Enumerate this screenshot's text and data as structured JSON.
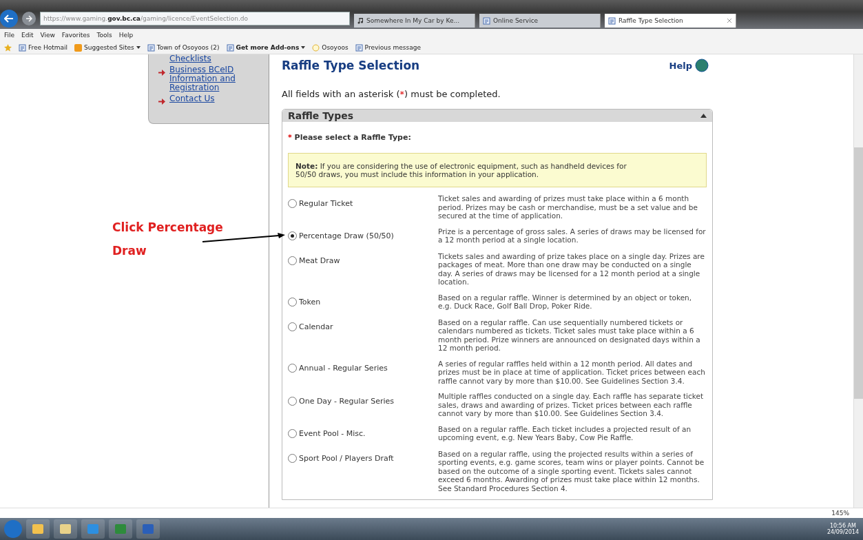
{
  "browser": {
    "url": {
      "prefix": "https://www.gaming.",
      "domain": "gov.bc.ca",
      "path": "/gaming/licence/EventSelection.do"
    },
    "tabs": [
      {
        "label": "Somewhere In My Car by Ke...",
        "kind": "music",
        "selected": false
      },
      {
        "label": "Online Service",
        "kind": "page",
        "selected": false
      },
      {
        "label": "Raffle Type Selection",
        "kind": "page",
        "selected": true
      }
    ],
    "menu": [
      "File",
      "Edit",
      "View",
      "Favorites",
      "Tools",
      "Help"
    ],
    "favorites": [
      {
        "label": "Free Hotmail",
        "kind": "page",
        "dropdown": false,
        "bold": false
      },
      {
        "label": "Suggested Sites",
        "kind": "suggested",
        "dropdown": true,
        "bold": false
      },
      {
        "label": "Town of Osoyoos (2)",
        "kind": "page",
        "dropdown": false,
        "bold": false
      },
      {
        "label": "Get more Add-ons",
        "kind": "page",
        "dropdown": true,
        "bold": true
      },
      {
        "label": "Osoyoos",
        "kind": "circle",
        "dropdown": false,
        "bold": false
      },
      {
        "label": "Previous message",
        "kind": "page",
        "dropdown": false,
        "bold": false
      }
    ],
    "zoom": "145%"
  },
  "sidebar": {
    "links": [
      {
        "label": "Checklists",
        "arrow": false
      },
      {
        "label": "Business BCeID Information and Registration",
        "arrow": true
      },
      {
        "label": "Contact Us",
        "arrow": true
      }
    ]
  },
  "page": {
    "title": "Raffle Type Selection",
    "help": "Help",
    "intro": {
      "before": "All fields with an asterisk (",
      "mark": "*",
      "after": ") must be completed."
    },
    "section": {
      "title": "Raffle Types",
      "expanded": true,
      "prompt": {
        "mark": "*",
        "text": "Please select a Raffle Type:"
      },
      "note": "**Note:** If you are considering the use of electronic equipment, such as handheld devices for 50/50 draws, you must include this information in your application.",
      "options": [
        {
          "label": "Regular Ticket",
          "selected": false,
          "description": "Ticket sales and awarding of prizes must take place within a 6 month period. Prizes may be cash or merchandise, must be a set value and be secured at the time of application."
        },
        {
          "label": "Percentage Draw (50/50)",
          "selected": true,
          "description": "Prize is a percentage of gross sales. A series of draws may be licensed for a 12 month period at a single location."
        },
        {
          "label": "Meat Draw",
          "selected": false,
          "description": "Tickets sales and awarding of prize takes place on a single day. Prizes are packages of meat. More than one draw may be conducted on a single day. A series of draws may be licensed for a 12 month period at a single location."
        },
        {
          "label": "Token",
          "selected": false,
          "description": "Based on a regular raffle. Winner is determined by an object or token, e.g. Duck Race, Golf Ball Drop, Poker Ride."
        },
        {
          "label": "Calendar",
          "selected": false,
          "description": "Based on a regular raffle. Can use sequentially numbered tickets or calendars numbered as tickets. Ticket sales must take place within a 6 month period. Prize winners are announced on designated days within a 12 month period."
        },
        {
          "label": "Annual - Regular Series",
          "selected": false,
          "description": "A series of regular raffles held within a 12 month period. All dates and prizes must be in place at time of application. Ticket prices between each raffle cannot vary by more than $10.00. See Guidelines Section 3.4."
        },
        {
          "label": "One Day - Regular Series",
          "selected": false,
          "description": "Multiple raffles conducted on a single day. Each raffle has separate ticket sales, draws and awarding of prizes. Ticket prices between each raffle cannot vary by more than $10.00. See Guidelines Section 3.4."
        },
        {
          "label": "Event Pool - Misc.",
          "selected": false,
          "description": "Based on a regular raffle. Each ticket includes a projected result of an upcoming event, e.g. New Years Baby, Cow Pie Raffle."
        },
        {
          "label": "Sport Pool / Players Draft",
          "selected": false,
          "description": "Based on a regular raffle, using the projected results within a series of sporting events, e.g. game scores, team wins or player points. Cannot be based on the outcome of a single sporting event. Tickets sales cannot exceed 6 months. Awarding of prizes must take place within 12 months. See Standard Procedures Section 4."
        }
      ]
    }
  },
  "annotation": [
    "Click Percentage",
    "Draw"
  ],
  "taskbar": {
    "time": "10:56 AM",
    "date": "24/09/2014"
  }
}
